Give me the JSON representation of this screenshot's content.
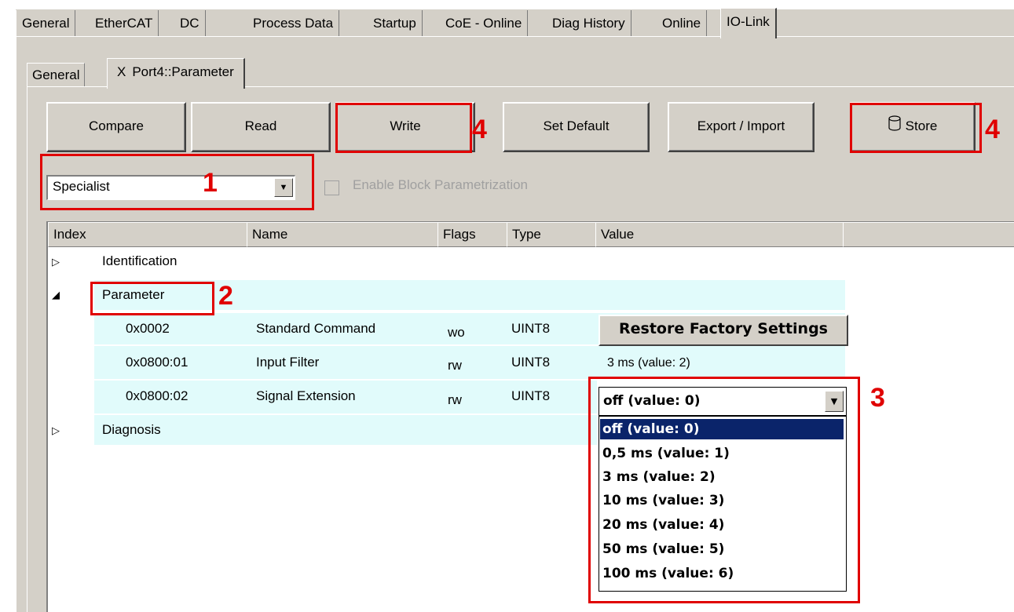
{
  "top_tabs": [
    "General",
    "EtherCAT",
    "DC",
    "Process Data",
    "Startup",
    "CoE - Online",
    "Diag History",
    "Online",
    "IO-Link"
  ],
  "inner_tabs": {
    "general": "General",
    "close_glyph": "X",
    "port": "Port4::Parameter"
  },
  "toolbar": {
    "compare": "Compare",
    "read": "Read",
    "write": "Write",
    "set_default": "Set Default",
    "export_import": "Export / Import",
    "store": "Store"
  },
  "mode_combo": {
    "value": "Specialist"
  },
  "block_param": {
    "label": "Enable Block Parametrization",
    "checked": false,
    "enabled": false
  },
  "markers": {
    "m1": "1",
    "m2": "2",
    "m3": "3",
    "m4a": "4",
    "m4b": "4"
  },
  "grid": {
    "headers": {
      "index": "Index",
      "name": "Name",
      "flags": "Flags",
      "type": "Type",
      "value": "Value"
    },
    "groups": {
      "identification": "Identification",
      "parameter": "Parameter",
      "diagnosis": "Diagnosis"
    },
    "rows": [
      {
        "index": "0x0002",
        "name": "Standard Command",
        "flags": "wo",
        "type": "UINT8",
        "value": "Restore Factory Settings"
      },
      {
        "index": "0x0800:01",
        "name": "Input Filter",
        "flags": "rw",
        "type": "UINT8",
        "value": "3 ms (value: 2)"
      },
      {
        "index": "0x0800:02",
        "name": "Signal Extension",
        "flags": "rw",
        "type": "UINT8",
        "value": "off (value: 0)"
      }
    ]
  },
  "dropdown_options": [
    "off (value: 0)",
    "0,5 ms (value: 1)",
    "3 ms (value: 2)",
    "10 ms (value: 3)",
    "20 ms (value: 4)",
    "50 ms (value: 5)",
    "100 ms (value: 6)"
  ],
  "colors": {
    "panel": "#d4d0c8",
    "highlight_row": "#e1fbfb",
    "annotation": "#e00000",
    "selection": "#0a246a"
  }
}
